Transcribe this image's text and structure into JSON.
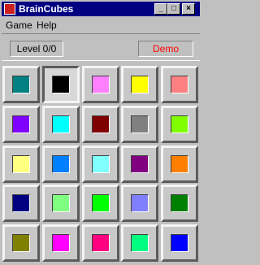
{
  "window": {
    "title": "BrainCubes"
  },
  "menu": {
    "game": "Game",
    "help": "Help"
  },
  "status": {
    "level": "Level 0/0",
    "mode": "Demo"
  },
  "grid": {
    "rows": [
      [
        "#008080",
        "#000000",
        "#ff80ff",
        "#ffff00",
        "#ff8080"
      ],
      [
        "#8000ff",
        "#00ffff",
        "#800000",
        "#808080",
        "#80ff00"
      ],
      [
        "#ffff80",
        "#0080ff",
        "#80ffff",
        "#800080",
        "#ff8000"
      ],
      [
        "#000080",
        "#80ff80",
        "#00ff00",
        "#8080ff",
        "#008000"
      ],
      [
        "#808000",
        "#ff00ff",
        "#ff0080",
        "#00ff80",
        "#0000ff"
      ]
    ],
    "pressed": [
      [
        0,
        1
      ]
    ]
  }
}
